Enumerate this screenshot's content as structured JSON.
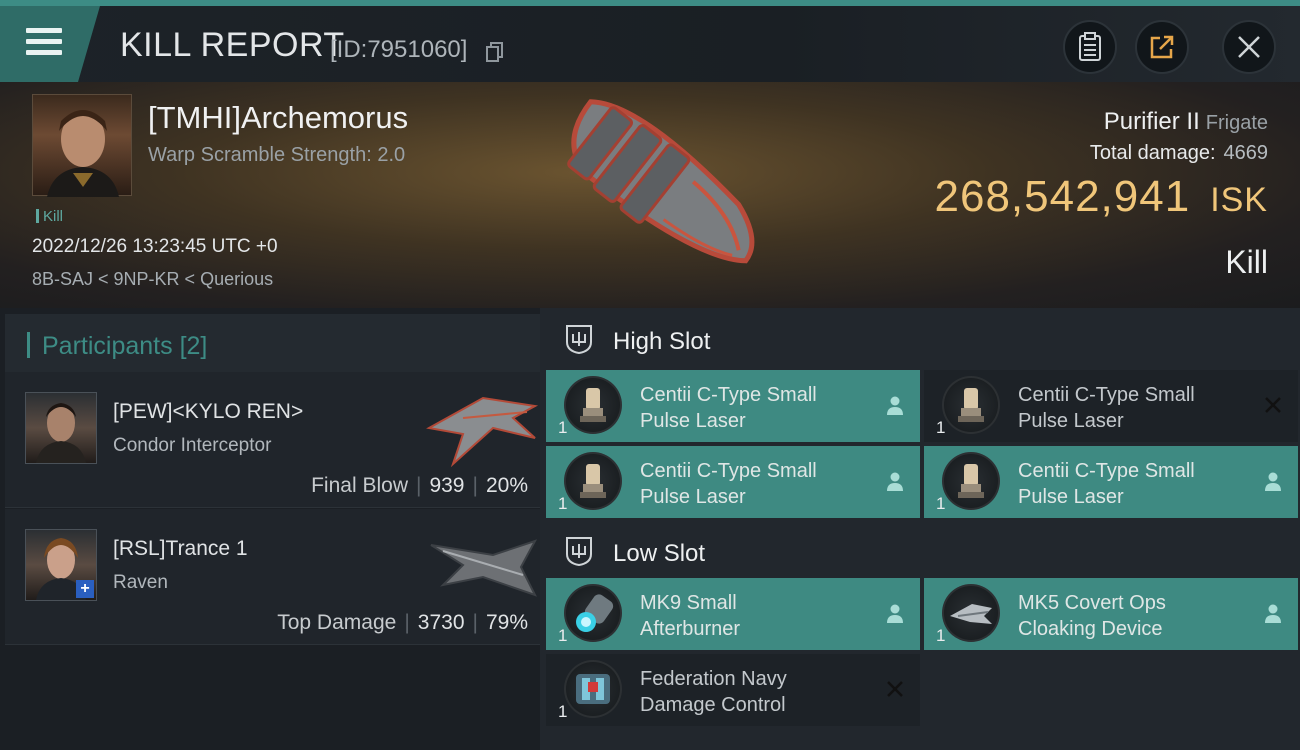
{
  "header": {
    "title": "KILL REPORT",
    "report_id": "[ID:7951060]",
    "colors": {
      "accent": "#3d8c85",
      "isk": "#f0c67a"
    }
  },
  "victim": {
    "name": "[TMHI]Archemorus",
    "warp_scramble": "Warp Scramble Strength: 2.0",
    "tag": "Kill",
    "datetime": "2022/12/26 13:23:45 UTC +0",
    "location": "8B-SAJ < 9NP-KR < Querious",
    "ship_name": "Purifier II",
    "ship_class": "Frigate",
    "total_damage_label": "Total damage:",
    "total_damage": "4669",
    "isk_value": "268,542,941",
    "isk_unit": "ISK",
    "result": "Kill"
  },
  "participants": {
    "label": "Participants",
    "count": "[2]",
    "items": [
      {
        "name": "[PEW]<KYLO REN>",
        "ship": "Condor Interceptor",
        "role": "Final Blow",
        "damage": "939",
        "percent": "20%"
      },
      {
        "name": "[RSL]Trance 1",
        "ship": "Raven",
        "role": "Top Damage",
        "damage": "3730",
        "percent": "79%"
      }
    ]
  },
  "slots": {
    "high": {
      "label": "High Slot",
      "modules": [
        {
          "line1": "Centii C-Type Small",
          "line2": "Pulse Laser",
          "qty": "1",
          "status_icon": "person-icon"
        },
        {
          "line1": "Centii C-Type Small",
          "line2": "Pulse Laser",
          "qty": "1",
          "status_icon": "close-icon"
        },
        {
          "line1": "Centii C-Type Small",
          "line2": "Pulse Laser",
          "qty": "1",
          "status_icon": "person-icon"
        },
        {
          "line1": "Centii C-Type Small",
          "line2": "Pulse Laser",
          "qty": "1",
          "status_icon": "person-icon"
        }
      ]
    },
    "low": {
      "label": "Low Slot",
      "modules": [
        {
          "line1": "MK9 Small",
          "line2": "Afterburner",
          "qty": "1",
          "status_icon": "person-icon"
        },
        {
          "line1": "MK5 Covert Ops",
          "line2": "Cloaking Device",
          "qty": "1",
          "status_icon": "person-icon"
        },
        {
          "line1": "Federation Navy",
          "line2": "Damage Control",
          "qty": "1",
          "status_icon": "close-icon"
        }
      ]
    }
  }
}
